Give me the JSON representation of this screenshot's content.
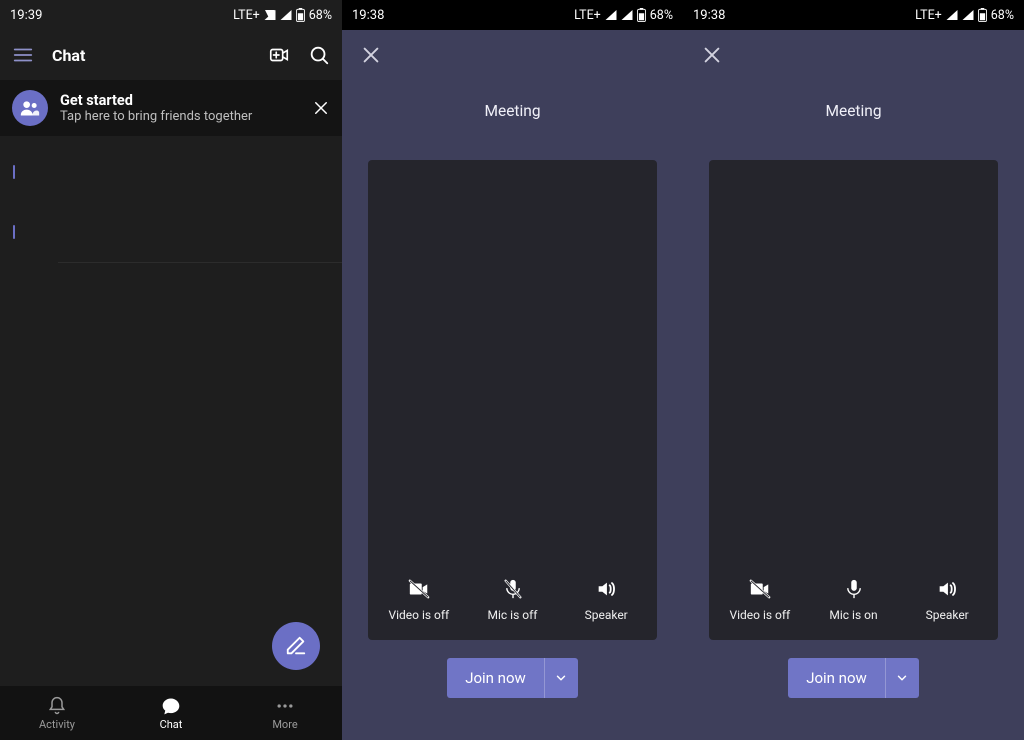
{
  "screen1": {
    "status": {
      "time": "19:39",
      "net": "LTE+",
      "battery": "68%"
    },
    "title": "Chat",
    "getstarted": {
      "title": "Get started",
      "subtitle": "Tap here to bring friends together"
    },
    "nav": {
      "activity": "Activity",
      "chat": "Chat",
      "more": "More"
    }
  },
  "screen2": {
    "status": {
      "time": "19:38",
      "net": "LTE+",
      "battery": "68%"
    },
    "title": "Meeting",
    "video": "Video is off",
    "mic": "Mic is off",
    "speaker": "Speaker",
    "join": "Join now"
  },
  "screen3": {
    "status": {
      "time": "19:38",
      "net": "LTE+",
      "battery": "68%"
    },
    "title": "Meeting",
    "video": "Video is off",
    "mic": "Mic is on",
    "speaker": "Speaker",
    "join": "Join now"
  }
}
